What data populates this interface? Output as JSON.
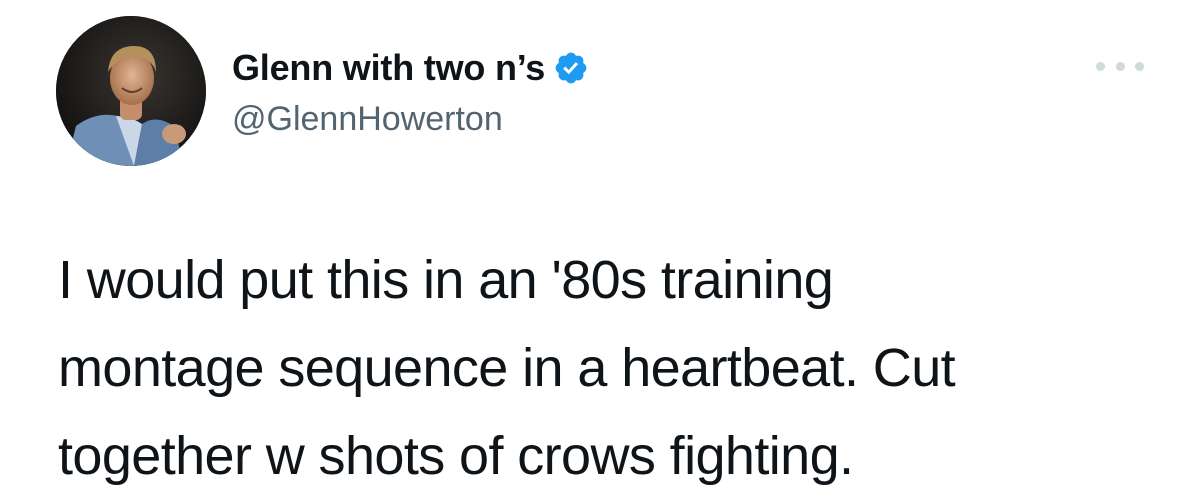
{
  "author": {
    "display_name": "Glenn with two n’s",
    "handle": "@GlennHowerton",
    "verified": true,
    "avatar_icon": "profile-photo",
    "verified_icon": "verified-badge-icon",
    "verified_color": "#1d9bf0"
  },
  "menu": {
    "icon": "more-options-icon"
  },
  "tweet": {
    "lines": [
      "I would put this in an '80s training",
      "montage sequence in a heartbeat. Cut",
      "together w shots of crows fighting."
    ]
  },
  "colors": {
    "text": "#0f1419",
    "secondary": "#536471",
    "dots": "#cfd9de",
    "background": "#ffffff"
  }
}
